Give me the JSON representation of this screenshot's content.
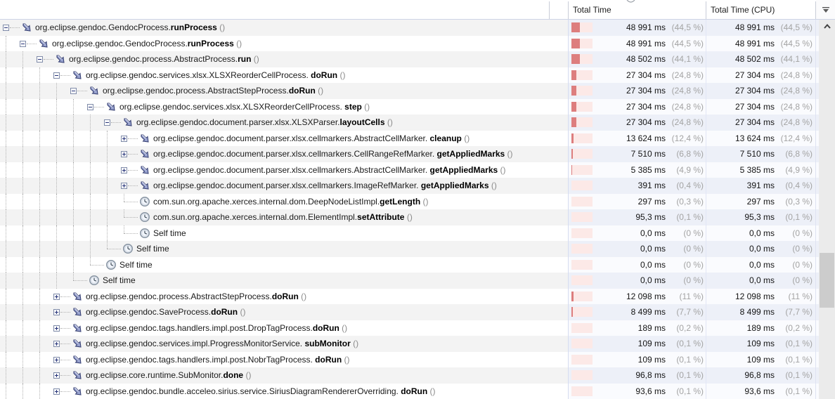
{
  "header": {
    "total_time": "Total Time",
    "total_time_cpu": "Total Time (CPU)"
  },
  "colors": {
    "bar_dark": "#dd7e7e",
    "bar_light": "#fce9e7",
    "stripe_tree": "#f3f3f3",
    "stripe_values": "#edf0f8"
  },
  "rows": [
    {
      "depth": 0,
      "expander": "minus",
      "icon": "method",
      "prefix": "org.eclipse.gendoc.GendocProcess.",
      "method": "runProcess",
      "suffix": " ()",
      "time": {
        "ms": "48 991 ms",
        "pct_label": "(44,5 %)",
        "pct": 44.5
      },
      "cpu": {
        "ms": "48 991 ms",
        "pct_label": "(44,5 %)",
        "pct": 44.5
      }
    },
    {
      "depth": 1,
      "expander": "minus",
      "icon": "method",
      "prefix": "org.eclipse.gendoc.GendocProcess.",
      "method": "runProcess",
      "suffix": " ()",
      "time": {
        "ms": "48 991 ms",
        "pct_label": "(44,5 %)",
        "pct": 44.5
      },
      "cpu": {
        "ms": "48 991 ms",
        "pct_label": "(44,5 %)",
        "pct": 44.5
      }
    },
    {
      "depth": 2,
      "expander": "minus",
      "icon": "method",
      "prefix": "org.eclipse.gendoc.process.AbstractProcess.",
      "method": "run",
      "suffix": " ()",
      "time": {
        "ms": "48 502 ms",
        "pct_label": "(44,1 %)",
        "pct": 44.1
      },
      "cpu": {
        "ms": "48 502 ms",
        "pct_label": "(44,1 %)",
        "pct": 44.1
      }
    },
    {
      "depth": 3,
      "expander": "minus",
      "icon": "method",
      "prefix": "org.eclipse.gendoc.services.xlsx.XLSXReorderCellProcess.",
      "method": " doRun",
      "suffix": " ()",
      "time": {
        "ms": "27 304 ms",
        "pct_label": "(24,8 %)",
        "pct": 24.8
      },
      "cpu": {
        "ms": "27 304 ms",
        "pct_label": "(24,8 %)",
        "pct": 24.8
      }
    },
    {
      "depth": 4,
      "expander": "minus",
      "icon": "method",
      "prefix": "org.eclipse.gendoc.process.AbstractStepProcess.",
      "method": "doRun",
      "suffix": " ()",
      "time": {
        "ms": "27 304 ms",
        "pct_label": "(24,8 %)",
        "pct": 24.8
      },
      "cpu": {
        "ms": "27 304 ms",
        "pct_label": "(24,8 %)",
        "pct": 24.8
      }
    },
    {
      "depth": 5,
      "expander": "minus",
      "icon": "method",
      "prefix": "org.eclipse.gendoc.services.xlsx.XLSXReorderCellProcess.",
      "method": " step",
      "suffix": " ()",
      "time": {
        "ms": "27 304 ms",
        "pct_label": "(24,8 %)",
        "pct": 24.8
      },
      "cpu": {
        "ms": "27 304 ms",
        "pct_label": "(24,8 %)",
        "pct": 24.8
      }
    },
    {
      "depth": 6,
      "expander": "minus",
      "icon": "method",
      "prefix": "org.eclipse.gendoc.document.parser.xlsx.XLSXParser.",
      "method": "layoutCells",
      "suffix": " ()",
      "time": {
        "ms": "27 304 ms",
        "pct_label": "(24,8 %)",
        "pct": 24.8
      },
      "cpu": {
        "ms": "27 304 ms",
        "pct_label": "(24,8 %)",
        "pct": 24.8
      }
    },
    {
      "depth": 7,
      "expander": "plus",
      "icon": "method",
      "prefix": "org.eclipse.gendoc.document.parser.xlsx.cellmarkers.AbstractCellMarker.",
      "method": " cleanup",
      "suffix": " ()",
      "time": {
        "ms": "13 624 ms",
        "pct_label": "(12,4 %)",
        "pct": 12.4
      },
      "cpu": {
        "ms": "13 624 ms",
        "pct_label": "(12,4 %)",
        "pct": 12.4
      }
    },
    {
      "depth": 7,
      "expander": "plus",
      "icon": "method",
      "prefix": "org.eclipse.gendoc.document.parser.xlsx.cellmarkers.CellRangeRefMarker.",
      "method": " getAppliedMarks",
      "suffix": " ()",
      "time": {
        "ms": "7 510 ms",
        "pct_label": "(6,8 %)",
        "pct": 6.8
      },
      "cpu": {
        "ms": "7 510 ms",
        "pct_label": "(6,8 %)",
        "pct": 6.8
      }
    },
    {
      "depth": 7,
      "expander": "plus",
      "icon": "method",
      "prefix": "org.eclipse.gendoc.document.parser.xlsx.cellmarkers.AbstractCellMarker.",
      "method": " getAppliedMarks",
      "suffix": " ()",
      "time": {
        "ms": "5 385 ms",
        "pct_label": "(4,9 %)",
        "pct": 4.9
      },
      "cpu": {
        "ms": "5 385 ms",
        "pct_label": "(4,9 %)",
        "pct": 4.9
      }
    },
    {
      "depth": 7,
      "expander": "plus",
      "icon": "method",
      "prefix": "org.eclipse.gendoc.document.parser.xlsx.cellmarkers.ImageRefMarker.",
      "method": " getAppliedMarks",
      "suffix": " ()",
      "time": {
        "ms": "391 ms",
        "pct_label": "(0,4 %)",
        "pct": 0.4
      },
      "cpu": {
        "ms": "391 ms",
        "pct_label": "(0,4 %)",
        "pct": 0.4
      }
    },
    {
      "depth": 7,
      "expander": null,
      "icon": "clock",
      "prefix": "com.sun.org.apache.xerces.internal.dom.DeepNodeListImpl.",
      "method": "getLength",
      "suffix": " ()",
      "time": {
        "ms": "297 ms",
        "pct_label": "(0,3 %)",
        "pct": 0.3
      },
      "cpu": {
        "ms": "297 ms",
        "pct_label": "(0,3 %)",
        "pct": 0.3
      }
    },
    {
      "depth": 7,
      "expander": null,
      "icon": "clock",
      "prefix": "com.sun.org.apache.xerces.internal.dom.ElementImpl.",
      "method": "setAttribute",
      "suffix": " ()",
      "time": {
        "ms": "95,3 ms",
        "pct_label": "(0,1 %)",
        "pct": 0.1
      },
      "cpu": {
        "ms": "95,3 ms",
        "pct_label": "(0,1 %)",
        "pct": 0.1
      }
    },
    {
      "depth": 7,
      "expander": null,
      "icon": "clock",
      "prefix": "Self time",
      "method": "",
      "suffix": "",
      "time": {
        "ms": "0,0 ms",
        "pct_label": "(0 %)",
        "pct": 0
      },
      "cpu": {
        "ms": "0,0 ms",
        "pct_label": "(0 %)",
        "pct": 0
      }
    },
    {
      "depth": 6,
      "expander": null,
      "icon": "clock",
      "prefix": "Self time",
      "method": "",
      "suffix": "",
      "time": {
        "ms": "0,0 ms",
        "pct_label": "(0 %)",
        "pct": 0
      },
      "cpu": {
        "ms": "0,0 ms",
        "pct_label": "(0 %)",
        "pct": 0
      }
    },
    {
      "depth": 5,
      "expander": null,
      "icon": "clock",
      "prefix": "Self time",
      "method": "",
      "suffix": "",
      "time": {
        "ms": "0,0 ms",
        "pct_label": "(0 %)",
        "pct": 0
      },
      "cpu": {
        "ms": "0,0 ms",
        "pct_label": "(0 %)",
        "pct": 0
      }
    },
    {
      "depth": 4,
      "expander": null,
      "icon": "clock",
      "prefix": "Self time",
      "method": "",
      "suffix": "",
      "time": {
        "ms": "0,0 ms",
        "pct_label": "(0 %)",
        "pct": 0
      },
      "cpu": {
        "ms": "0,0 ms",
        "pct_label": "(0 %)",
        "pct": 0
      }
    },
    {
      "depth": 3,
      "expander": "plus",
      "icon": "method",
      "prefix": "org.eclipse.gendoc.process.AbstractStepProcess.",
      "method": "doRun",
      "suffix": " ()",
      "time": {
        "ms": "12 098 ms",
        "pct_label": "(11 %)",
        "pct": 11
      },
      "cpu": {
        "ms": "12 098 ms",
        "pct_label": "(11 %)",
        "pct": 11
      }
    },
    {
      "depth": 3,
      "expander": "plus",
      "icon": "method",
      "prefix": "org.eclipse.gendoc.SaveProcess.",
      "method": "doRun",
      "suffix": " ()",
      "time": {
        "ms": "8 499 ms",
        "pct_label": "(7,7 %)",
        "pct": 7.7
      },
      "cpu": {
        "ms": "8 499 ms",
        "pct_label": "(7,7 %)",
        "pct": 7.7
      }
    },
    {
      "depth": 3,
      "expander": "plus",
      "icon": "method",
      "prefix": "org.eclipse.gendoc.tags.handlers.impl.post.DropTagProcess.",
      "method": "doRun",
      "suffix": " ()",
      "time": {
        "ms": "189 ms",
        "pct_label": "(0,2 %)",
        "pct": 0.2
      },
      "cpu": {
        "ms": "189 ms",
        "pct_label": "(0,2 %)",
        "pct": 0.2
      }
    },
    {
      "depth": 3,
      "expander": "plus",
      "icon": "method",
      "prefix": "org.eclipse.gendoc.services.impl.ProgressMonitorService.",
      "method": " subMonitor",
      "suffix": " ()",
      "time": {
        "ms": "109 ms",
        "pct_label": "(0,1 %)",
        "pct": 0.1
      },
      "cpu": {
        "ms": "109 ms",
        "pct_label": "(0,1 %)",
        "pct": 0.1
      }
    },
    {
      "depth": 3,
      "expander": "plus",
      "icon": "method",
      "prefix": "org.eclipse.gendoc.tags.handlers.impl.post.NobrTagProcess.",
      "method": " doRun",
      "suffix": " ()",
      "time": {
        "ms": "109 ms",
        "pct_label": "(0,1 %)",
        "pct": 0.1
      },
      "cpu": {
        "ms": "109 ms",
        "pct_label": "(0,1 %)",
        "pct": 0.1
      }
    },
    {
      "depth": 3,
      "expander": "plus",
      "icon": "method",
      "prefix": "org.eclipse.core.runtime.SubMonitor.",
      "method": "done",
      "suffix": " ()",
      "time": {
        "ms": "96,8 ms",
        "pct_label": "(0,1 %)",
        "pct": 0.1
      },
      "cpu": {
        "ms": "96,8 ms",
        "pct_label": "(0,1 %)",
        "pct": 0.1
      }
    },
    {
      "depth": 3,
      "expander": "plus",
      "icon": "method",
      "prefix": "org.eclipse.gendoc.bundle.acceleo.sirius.service.SiriusDiagramRendererOverriding.",
      "method": " doRun",
      "suffix": " ()",
      "time": {
        "ms": "93,6 ms",
        "pct_label": "(0,1 %)",
        "pct": 0.1
      },
      "cpu": {
        "ms": "93,6 ms",
        "pct_label": "(0,1 %)",
        "pct": 0.1
      }
    }
  ]
}
